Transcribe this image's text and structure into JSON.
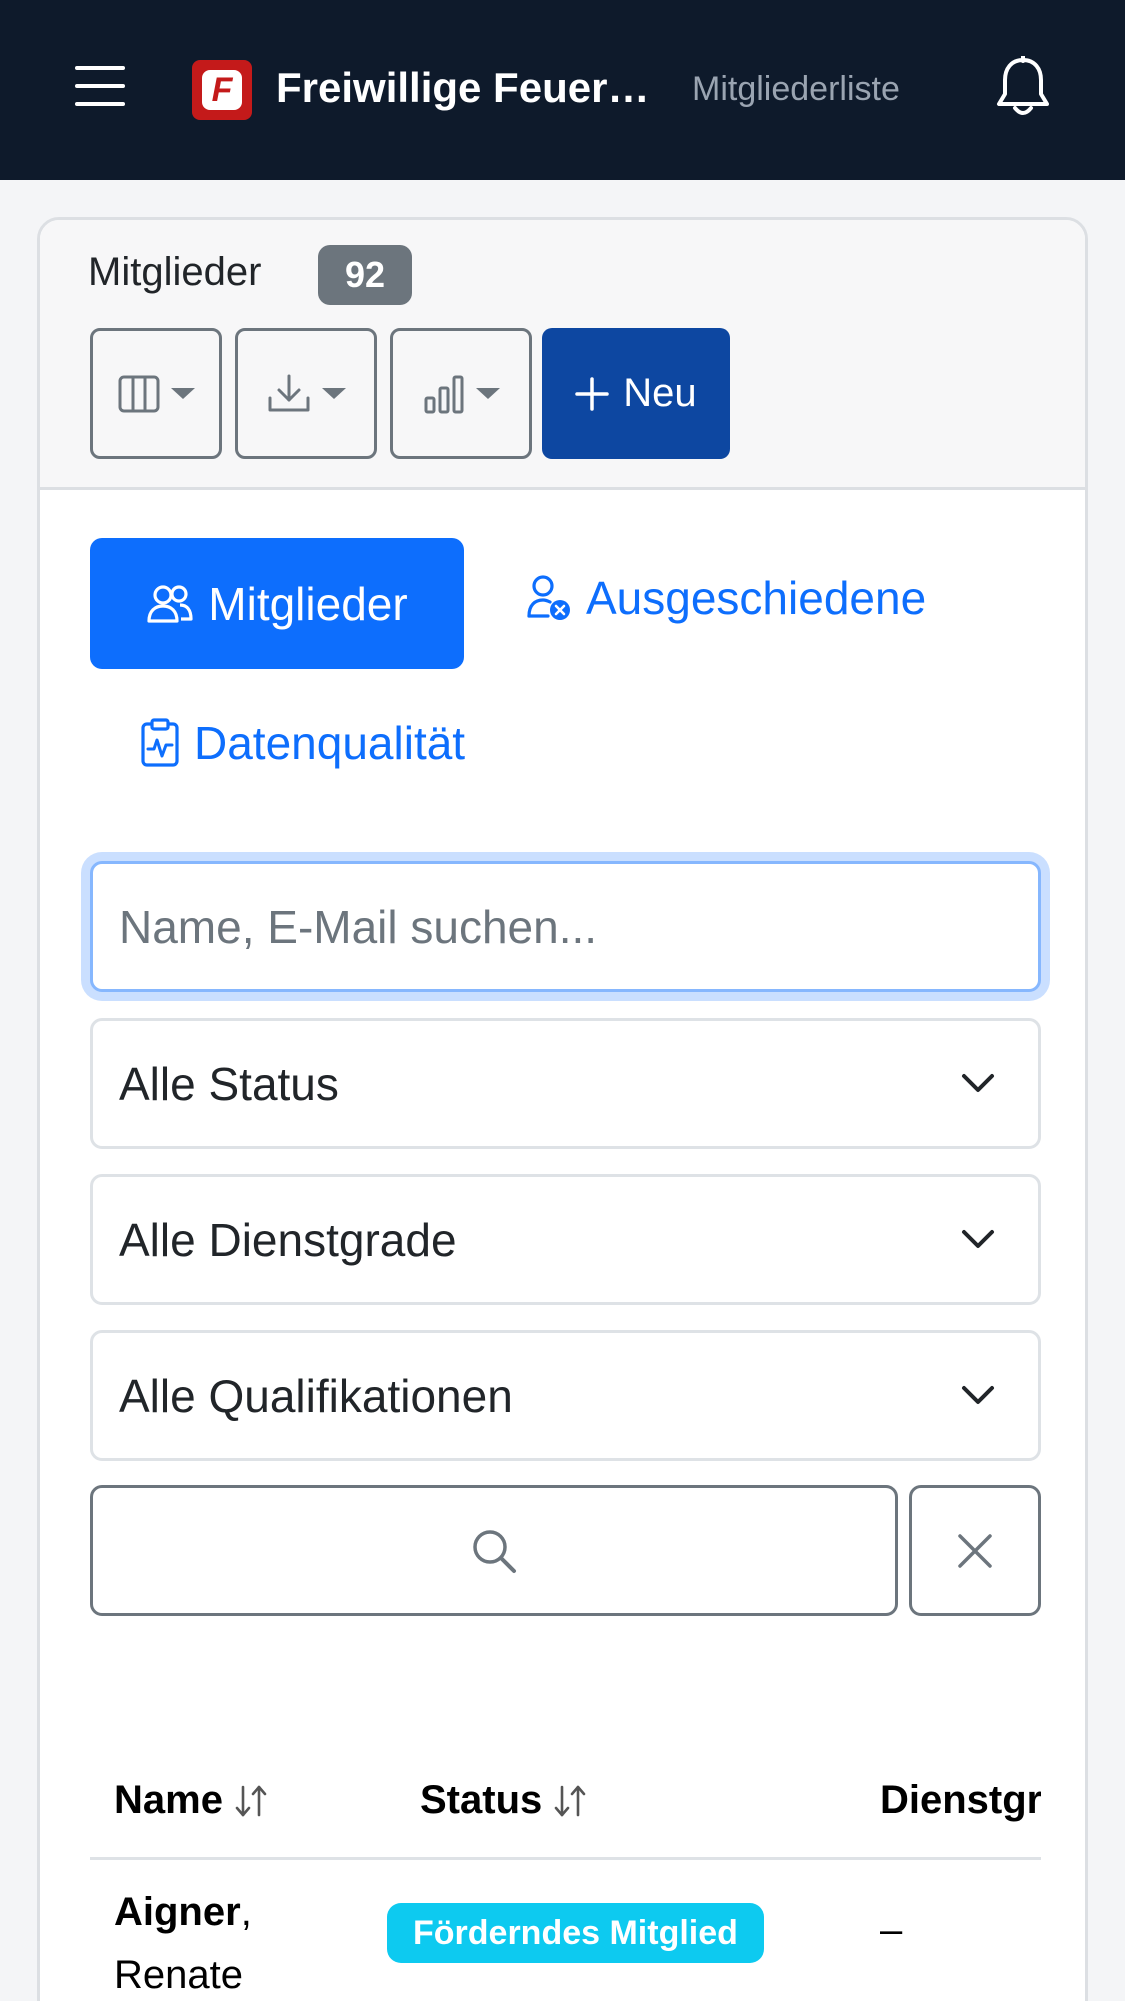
{
  "navbar": {
    "brand_letter": "F",
    "brand_title": "Freiwillige Feuerwehr",
    "page_label": "Mitgliederliste"
  },
  "card": {
    "title": "Mitglieder",
    "count": "92",
    "new_button_label": "Neu"
  },
  "tabs": [
    {
      "label": "Mitglieder",
      "active": true,
      "icon": "people-icon"
    },
    {
      "label": "Ausgeschiedene",
      "active": false,
      "icon": "person-x-icon"
    },
    {
      "label": "Datenqualität",
      "active": false,
      "icon": "clipboard-pulse-icon"
    }
  ],
  "filters": {
    "search_placeholder": "Name, E-Mail suchen...",
    "search_value": "",
    "status_selected": "Alle Status",
    "rank_selected": "Alle Dienstgrade",
    "qualification_selected": "Alle Qualifikationen"
  },
  "table": {
    "headers": [
      "Name",
      "Status",
      "Dienstgrad"
    ],
    "rows": [
      {
        "last_name": "Aigner",
        "first_name": "Renate",
        "status": "Förderndes Mitglied",
        "rank": "–"
      }
    ]
  },
  "colors": {
    "navbar_bg": "#0e1a2b",
    "primary": "#0d6efd",
    "new_button": "#0d47a1",
    "badge_info": "#0dcaf0",
    "badge_secondary": "#6c757d",
    "brand_red": "#c41a1a"
  }
}
